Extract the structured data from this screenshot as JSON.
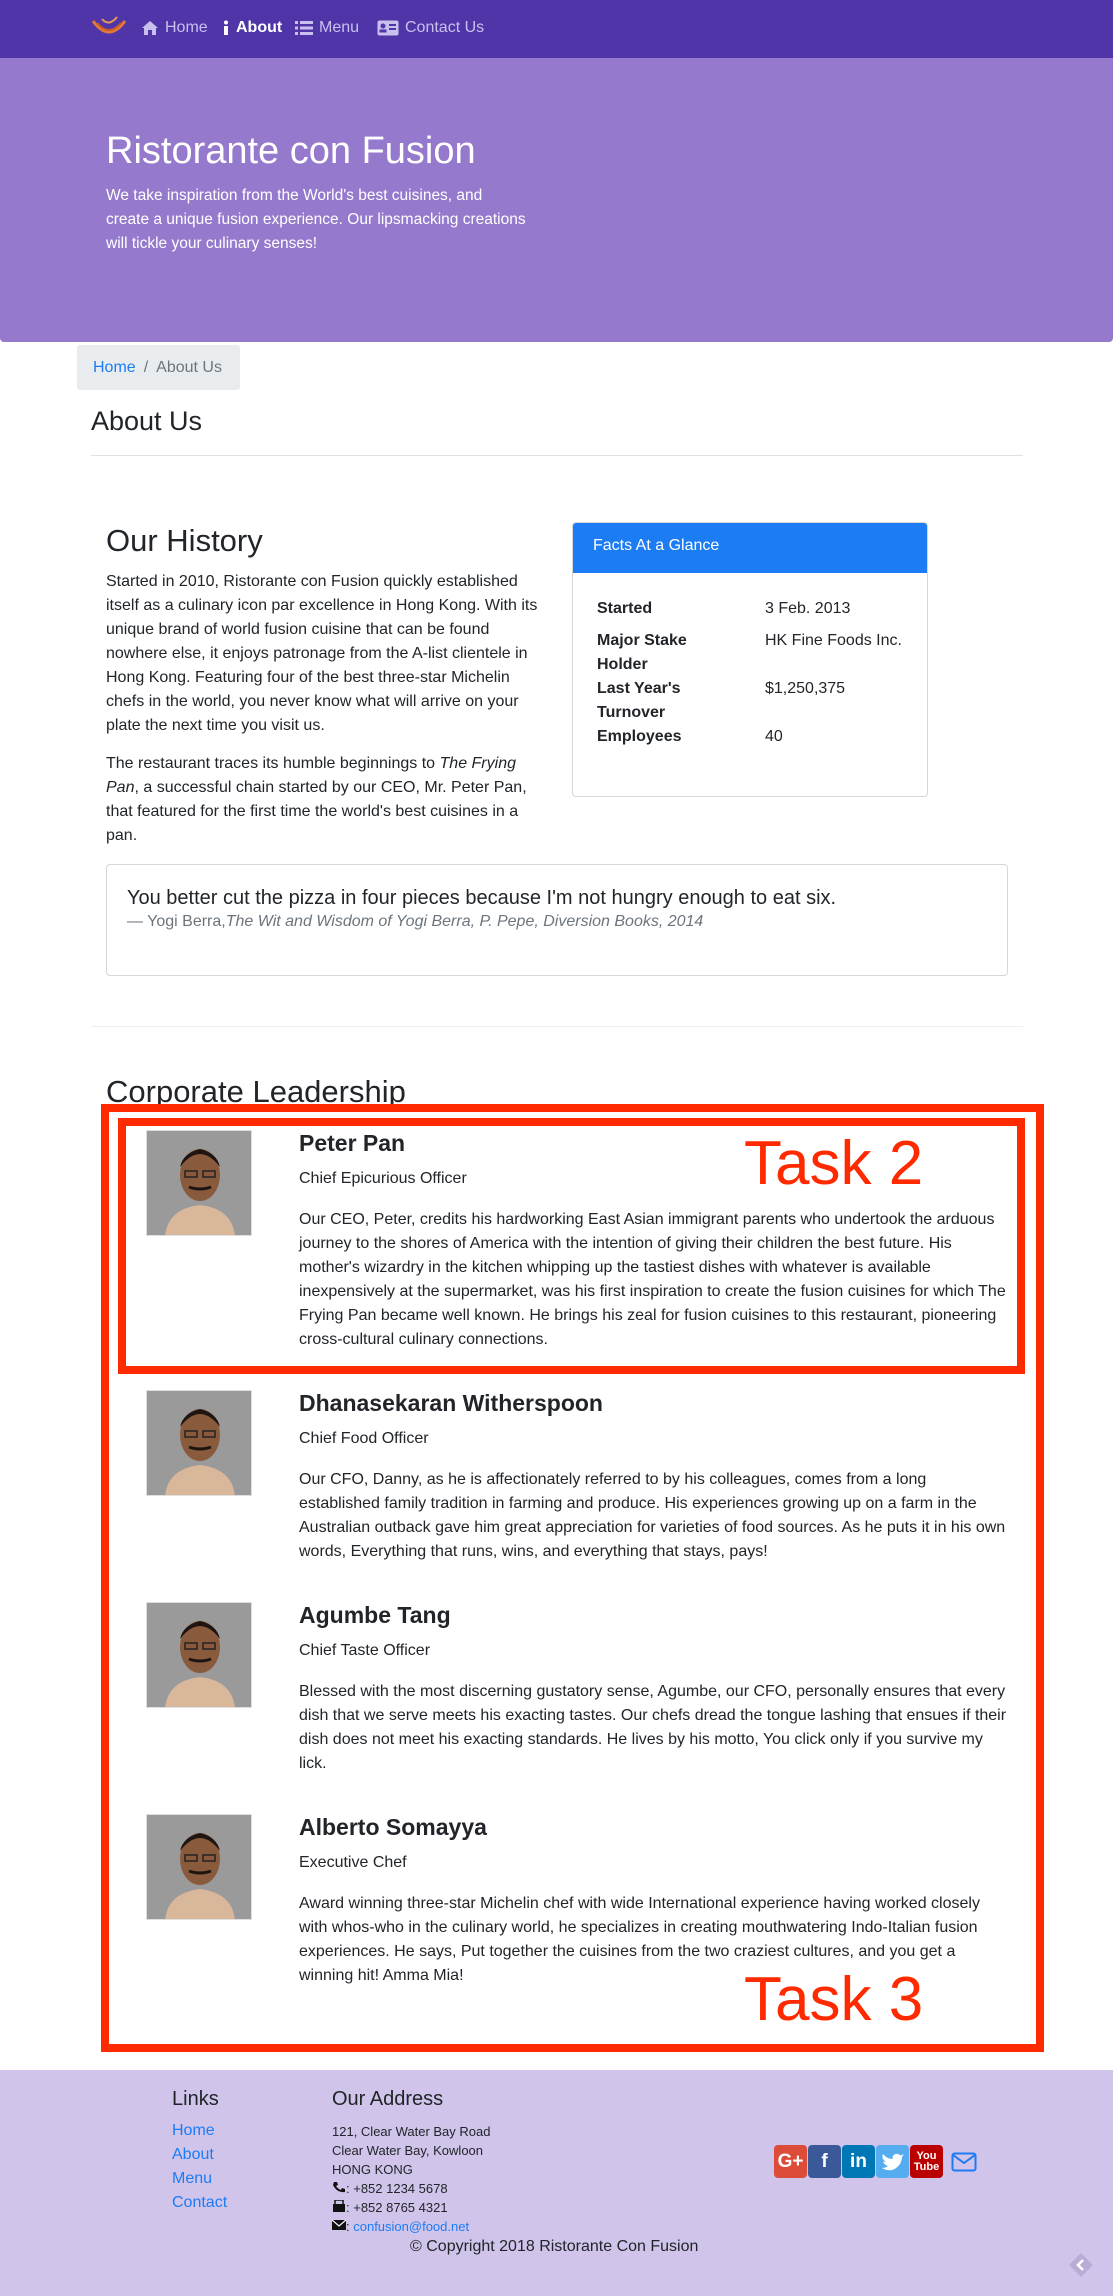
{
  "nav": {
    "items": [
      {
        "label": "Home",
        "icon": "home-icon"
      },
      {
        "label": "About",
        "icon": "info-icon"
      },
      {
        "label": "Menu",
        "icon": "list-icon"
      },
      {
        "label": "Contact Us",
        "icon": "address-card-icon"
      }
    ]
  },
  "jumbotron": {
    "title": "Ristorante con Fusion",
    "text": "We take inspiration from the World's best cuisines, and create a unique fusion experience. Our lipsmacking creations will tickle your culinary senses!"
  },
  "breadcrumb": {
    "home": "Home",
    "separator": "/",
    "current": "About Us"
  },
  "page_title": "About Us",
  "history": {
    "title": "Our History",
    "p1": "Started in 2010, Ristorante con Fusion quickly established itself as a culinary icon par excellence in Hong Kong. With its unique brand of world fusion cuisine that can be found nowhere else, it enjoys patronage from the A-list clientele in Hong Kong. Featuring four of the best three-star Michelin chefs in the world, you never know what will arrive on your plate the next time you visit us.",
    "p2_a": "The restaurant traces its humble beginnings to ",
    "p2_em": "The Frying Pan",
    "p2_b": ", a successful chain started by our CEO, Mr. Peter Pan, that featured for the first time the world's best cuisines in a pan."
  },
  "facts": {
    "title": "Facts At a Glance",
    "rows": [
      {
        "term": "Started",
        "value": "3 Feb. 2013"
      },
      {
        "term": "Major Stake Holder",
        "value": "HK Fine Foods Inc."
      },
      {
        "term": "Last Year's Turnover",
        "value": "$1,250,375"
      },
      {
        "term": "Employees",
        "value": "40"
      }
    ]
  },
  "quote": {
    "text": "You better cut the pizza in four pieces because I'm not hungry enough to eat six.",
    "dash": "— ",
    "author": "Yogi Berra,",
    "source": "The Wit and Wisdom of Yogi Berra, P. Pepe, Diversion Books, 2014"
  },
  "leadership": {
    "title": "Corporate Leadership",
    "leaders": [
      {
        "name": "Peter Pan",
        "role": "Chief Epicurious Officer",
        "bio": "Our CEO, Peter, credits his hardworking East Asian immigrant parents who undertook the arduous journey to the shores of America with the intention of giving their children the best future. His mother's wizardry in the kitchen whipping up the tastiest dishes with whatever is available inexpensively at the supermarket, was his first inspiration to create the fusion cuisines for which The Frying Pan became well known. He brings his zeal for fusion cuisines to this restaurant, pioneering cross-cultural culinary connections."
      },
      {
        "name": "Dhanasekaran Witherspoon",
        "role": "Chief Food Officer",
        "bio": "Our CFO, Danny, as he is affectionately referred to by his colleagues, comes from a long established family tradition in farming and produce. His experiences growing up on a farm in the Australian outback gave him great appreciation for varieties of food sources. As he puts it in his own words, Everything that runs, wins, and everything that stays, pays!"
      },
      {
        "name": "Agumbe Tang",
        "role": "Chief Taste Officer",
        "bio": "Blessed with the most discerning gustatory sense, Agumbe, our CFO, personally ensures that every dish that we serve meets his exacting tastes. Our chefs dread the tongue lashing that ensues if their dish does not meet his exacting standards. He lives by his motto, You click only if you survive my lick."
      },
      {
        "name": "Alberto Somayya",
        "role": "Executive Chef",
        "bio": "Award winning three-star Michelin chef with wide International experience having worked closely with whos-who in the culinary world, he specializes in creating mouthwatering Indo-Italian fusion experiences. He says, Put together the cuisines from the two craziest cultures, and you get a winning hit! Amma Mia!"
      }
    ]
  },
  "annotations": {
    "task2": "Task 2",
    "task3": "Task 3",
    "color": "#ff2a00"
  },
  "footer": {
    "links_title": "Links",
    "links": [
      "Home",
      "About",
      "Menu",
      "Contact"
    ],
    "address_title": "Our Address",
    "address": [
      "121, Clear Water Bay Road",
      "Clear Water Bay, Kowloon",
      "HONG KONG"
    ],
    "phone": ": +852 1234 5678",
    "fax": ": +852 8765 4321",
    "email_sep": ": ",
    "email": "confusion@food.net",
    "social": [
      "google-plus-icon",
      "facebook-icon",
      "linkedin-icon",
      "twitter-icon",
      "youtube-icon",
      "mail-icon"
    ],
    "copyright": "© Copyright 2018 Ristorante Con Fusion"
  },
  "colors": {
    "navbar": "#4f35a8",
    "jumbotron": "#9579cc",
    "footer": "#d0c4ea",
    "primary": "#1c7cf4"
  }
}
